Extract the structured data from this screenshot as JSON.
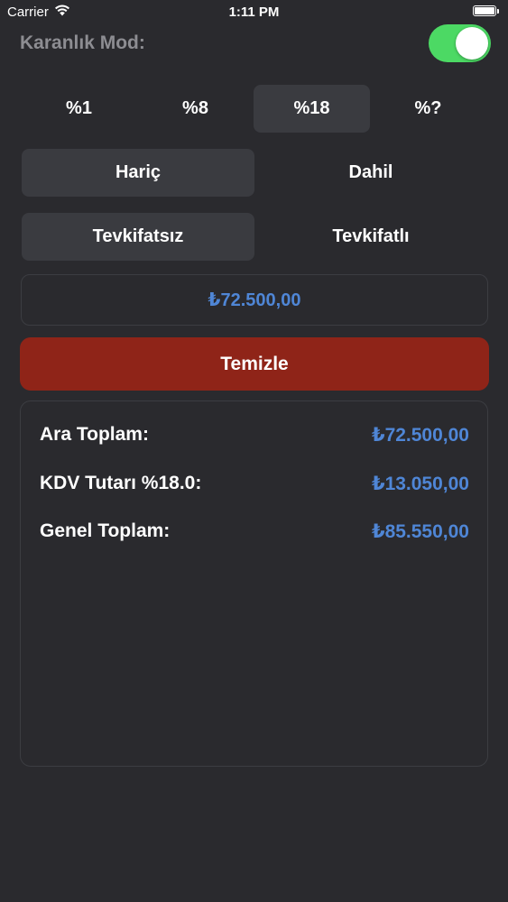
{
  "status_bar": {
    "carrier": "Carrier",
    "time": "1:11 PM"
  },
  "dark_mode": {
    "label": "Karanlık Mod:",
    "enabled": true,
    "toggle_color": "#4cd964"
  },
  "rates": {
    "items": [
      {
        "label": "%1",
        "selected": false
      },
      {
        "label": "%8",
        "selected": false
      },
      {
        "label": "%18",
        "selected": true
      },
      {
        "label": "%?",
        "selected": false
      }
    ]
  },
  "inclusion": {
    "items": [
      {
        "label": "Hariç",
        "selected": true
      },
      {
        "label": "Dahil",
        "selected": false
      }
    ]
  },
  "withholding": {
    "items": [
      {
        "label": "Tevkifatsız",
        "selected": true
      },
      {
        "label": "Tevkifatlı",
        "selected": false
      }
    ]
  },
  "amount_input": {
    "value": "₺72.500,00"
  },
  "clear_button": {
    "label": "Temizle",
    "color": "#8f2418"
  },
  "results": {
    "rows": [
      {
        "label": "Ara Toplam:",
        "value": "₺72.500,00"
      },
      {
        "label": "KDV Tutarı %18.0:",
        "value": "₺13.050,00"
      },
      {
        "label": "Genel Toplam:",
        "value": "₺85.550,00"
      }
    ],
    "value_color": "#4f86d6"
  }
}
